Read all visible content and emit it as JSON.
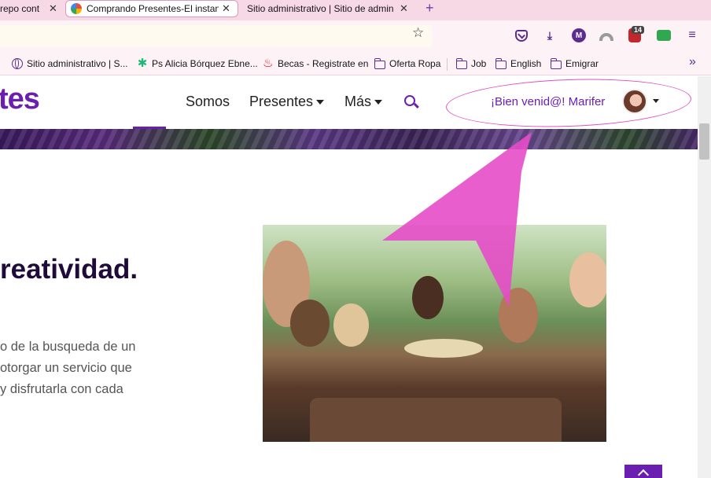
{
  "browser": {
    "tabs": [
      {
        "label": "repo cont",
        "active": false
      },
      {
        "label": "Comprando Presentes-El instan",
        "active": true
      },
      {
        "label": "Sitio administrativo | Sitio de admin",
        "active": false
      }
    ],
    "close_glyph": "✕",
    "new_tab_glyph": "+",
    "star_glyph": "☆",
    "menu_glyph": "≡",
    "download_glyph": "⤓",
    "m_label": "M",
    "ext_badge": "14",
    "bookmarks": [
      {
        "label": "Sitio administrativo | S...",
        "icon": "globe-icon"
      },
      {
        "label": "Ps Alicia Bórquez Ebne...",
        "icon": "star-icon"
      },
      {
        "label": "Becas - Registrate en",
        "icon": "flame-icon"
      },
      {
        "label": "Oferta Ropa",
        "icon": "folder-icon"
      },
      {
        "label": "Job",
        "icon": "folder-icon"
      },
      {
        "label": "English",
        "icon": "folder-icon"
      },
      {
        "label": "Emigrar",
        "icon": "folder-icon"
      }
    ],
    "more_bookmarks_glyph": "»"
  },
  "site": {
    "logo": "tes",
    "menu": {
      "somos": "Somos",
      "presentes": "Presentes",
      "mas": "Más"
    },
    "welcome": "¡Bien venid@! Marifer",
    "headline": "reatividad.",
    "body_lines": [
      "o de la busqueda de un",
      "otorgar un servicio que",
      "y disfrutarla con cada"
    ]
  },
  "colors": {
    "brand": "#6b1fb1",
    "annotation": "#e04fc6",
    "tabstrip": "#f7d9e6"
  }
}
